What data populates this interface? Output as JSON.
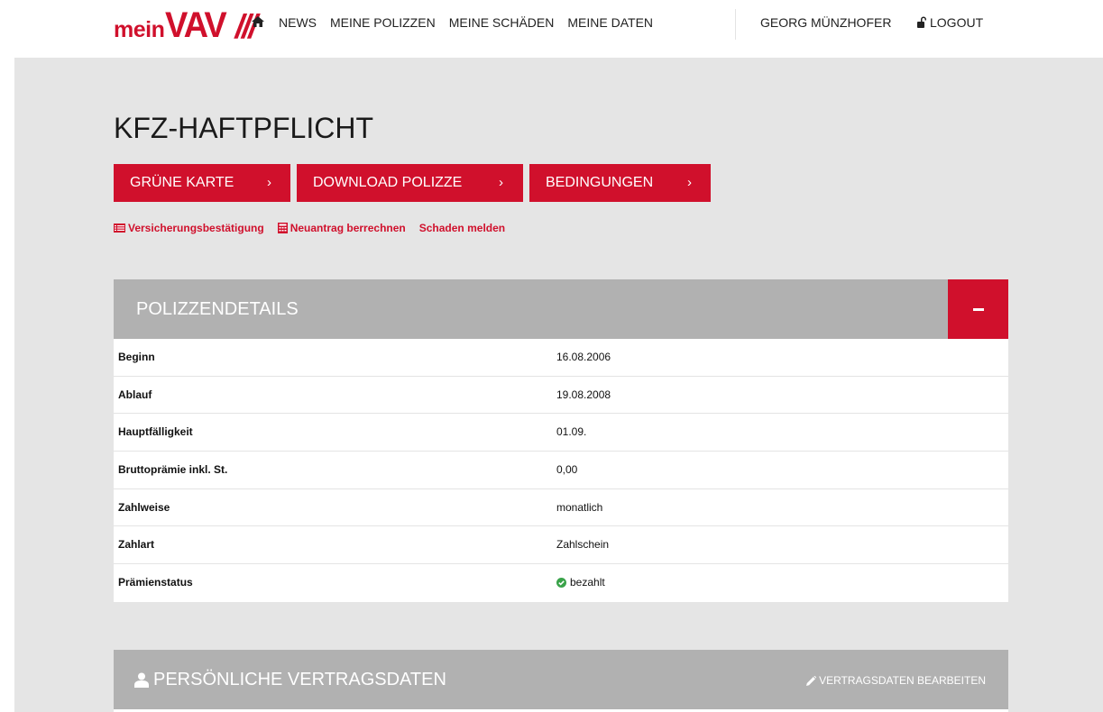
{
  "brand": {
    "prefix": "mein",
    "name": "VAV",
    "mark": "///",
    "color": "#d0102c"
  },
  "nav": {
    "home_icon": "home-icon",
    "items": [
      {
        "label": "NEWS"
      },
      {
        "label": "MEINE POLIZZEN"
      },
      {
        "label": "MEINE SCHÄDEN"
      },
      {
        "label": "MEINE DATEN"
      }
    ],
    "user": "GEORG MÜNZHOFER",
    "logout": "LOGOUT"
  },
  "page": {
    "title": "KFZ-HAFTPFLICHT",
    "buttons": [
      {
        "label": "GRÜNE KARTE",
        "chevron": "›"
      },
      {
        "label": "DOWNLOAD POLIZZE",
        "chevron": "›"
      },
      {
        "label": "BEDINGUNGEN",
        "chevron": "›"
      }
    ],
    "links": [
      {
        "label": "Versicherungsbestätigung",
        "icon": "list-icon"
      },
      {
        "label": "Neuantrag berrechnen",
        "icon": "calculator-icon"
      },
      {
        "label": "Schaden melden"
      }
    ]
  },
  "details_panel": {
    "title": "POLIZZENDETAILS",
    "rows": [
      {
        "label": "Beginn",
        "value": "16.08.2006"
      },
      {
        "label": "Ablauf",
        "value": "19.08.2008"
      },
      {
        "label": "Hauptfälligkeit",
        "value": "01.09."
      },
      {
        "label": "Bruttoprämie inkl. St.",
        "value": "0,00"
      },
      {
        "label": "Zahlweise",
        "value": "monatlich"
      },
      {
        "label": "Zahlart",
        "value": "Zahlschein"
      },
      {
        "label": "Prämienstatus",
        "value": "bezahlt",
        "status_color": "#3aa34a"
      }
    ]
  },
  "contract_panel": {
    "title": "PERSÖNLICHE VERTRAGSDATEN",
    "edit_label": "VERTRAGSDATEN BEARBEITEN"
  }
}
